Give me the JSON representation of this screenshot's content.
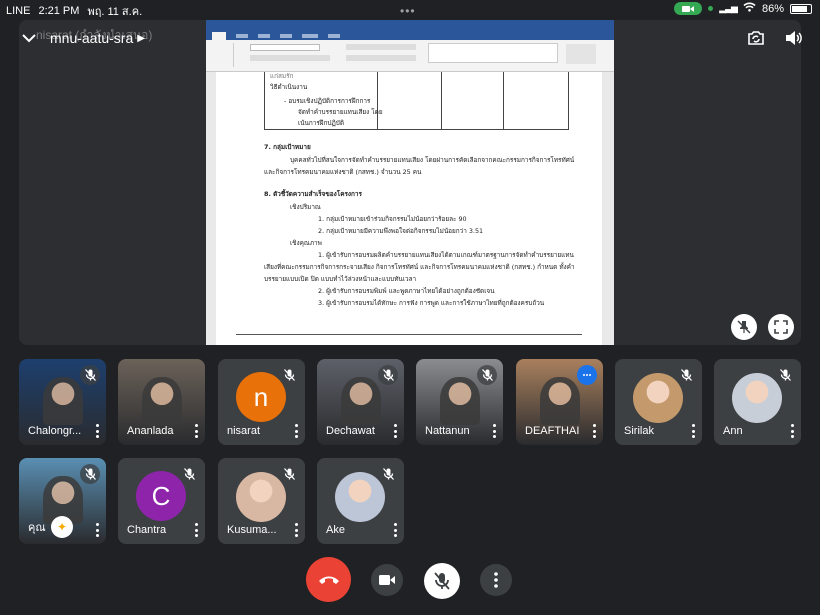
{
  "status_bar": {
    "app": "LINE",
    "time": "2:21 PM",
    "date": "พฤ. 11 ส.ค.",
    "battery": "86%"
  },
  "meeting": {
    "code": "mnu-aatu-sra",
    "presenter_note": "nisarat (กำลังนำเสนอ)"
  },
  "document": {
    "lines": [
      "แก่สมรัก",
      "วิธีดำเนินงาน",
      "-     อบรมเชิงปฏิบัติการการฝึกการ",
      "จัดทำคำบรรยายแทนเสียง โดย",
      "เน้นการฝึกปฏิบัติ",
      "7. กลุ่มเป้าหมาย",
      "บุคคลทั่วไปที่สนใจการจัดทำคำบรรยายแทนเสียง โดยผ่านการคัดเลือกจากคณะกรรมการกิจการโทรทัศน์",
      "และกิจการโทรคมนาคมแห่งชาติ (กสทช.) จำนวน 25 คน",
      "8. ตัวชี้วัดความสำเร็จของโครงการ",
      "เชิงปริมาณ",
      "1. กลุ่มเป้าหมายเข้าร่วมกิจกรรมไม่น้อยกว่าร้อยละ 90",
      "2. กลุ่มเป้าหมายมีความพึงพอใจต่อกิจกรรมไม่น้อยกว่า 3.51",
      "เชิงคุณภาพ",
      "1. ผู้เข้ารับการอบรมผลิตคำบรรยายแทนเสียงได้ตามเกณฑ์มาตรฐานการจัดทำคำบรรยายแทน",
      "เสียงที่คณะกรรมการกิจการกระจายเสียง กิจการโทรทัศน์ และกิจการโทรคมนาคมแห่งชาติ (กสทช.) กำหนด ทั้งคำ",
      "บรรยายแบบเปิด ปิด แบบทำไว้ล่วงหน้าและแบบทันเวลา",
      "2. ผู้เข้ารับการอบรมพิมพ์ และพูดภาษาไทยได้อย่างถูกต้องชัดเจน",
      "3. ผู้เข้ารับการอบรมได้ทักษะ การฟัง การพูด และการใช้ภาษาไทยที่ถูกต้องครบถ้วน"
    ]
  },
  "participants": [
    {
      "name": "Chalongr...",
      "kind": "photo",
      "bg": "#1d3f6e",
      "muted": true
    },
    {
      "name": "Ananlada",
      "kind": "photo",
      "bg": "#6b6259",
      "muted": false
    },
    {
      "name": "nisarat",
      "kind": "letter",
      "letter": "n",
      "bg": "#e8710a",
      "muted": true
    },
    {
      "name": "Dechawat",
      "kind": "photo",
      "bg": "#5d6068",
      "muted": true
    },
    {
      "name": "Nattanun",
      "kind": "photo",
      "bg": "#8a8c90",
      "muted": true
    },
    {
      "name": "DEAFTHAI",
      "kind": "photo",
      "bg": "#a9805d",
      "muted": false,
      "speaking": true
    },
    {
      "name": "Sirilak",
      "kind": "photo-circle",
      "bg": "#c49a6c",
      "muted": true
    },
    {
      "name": "Ann",
      "kind": "photo-circle",
      "bg": "#c8ced8",
      "muted": true
    },
    {
      "name": "คุณ",
      "kind": "photo",
      "bg": "#5a8fb3",
      "muted": true,
      "self": true
    },
    {
      "name": "Chantra",
      "kind": "letter",
      "letter": "C",
      "bg": "#8e24aa",
      "muted": true
    },
    {
      "name": "Kusuma...",
      "kind": "photo-circle",
      "bg": "#d9b8a3",
      "muted": true
    },
    {
      "name": "Ake",
      "kind": "photo-circle",
      "bg": "#bdc6d6",
      "muted": true
    }
  ],
  "controls": {
    "end_call_color": "#ea4335",
    "camera_icon": "video-camera-icon",
    "mic_icon": "mic-off-icon",
    "more_icon": "more-vertical-icon"
  }
}
